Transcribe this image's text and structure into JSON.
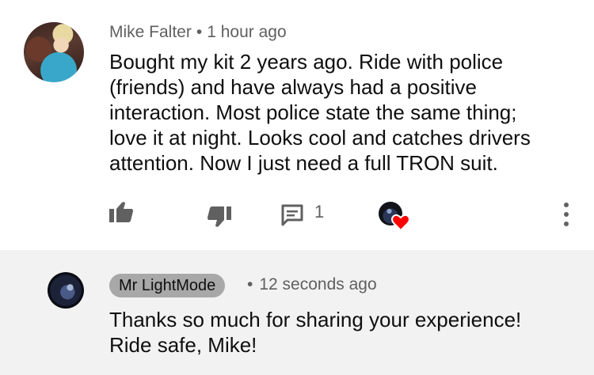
{
  "comment": {
    "author": "Mike Falter",
    "separator": "•",
    "time": "1 hour ago",
    "lines": [
      "Bought my kit 2 years ago.  Ride with police",
      "(friends) and have always had a positive",
      "interaction.  Most police state the same thing;",
      "love it at night.  Looks cool and catches drivers",
      "attention. Now I just need a full TRON suit."
    ],
    "reply_count": "1",
    "icons": {
      "like": "thumb-up-icon",
      "dislike": "thumb-down-icon",
      "reply": "comment-icon",
      "creator_heart": "heart-icon",
      "more": "more-vertical-icon"
    },
    "heart_color": "#ff0000"
  },
  "reply": {
    "author": "Mr LightMode",
    "separator": "•",
    "time": "12 seconds ago",
    "lines": [
      "Thanks so much for sharing your experience!",
      "Ride safe, Mike!"
    ]
  }
}
